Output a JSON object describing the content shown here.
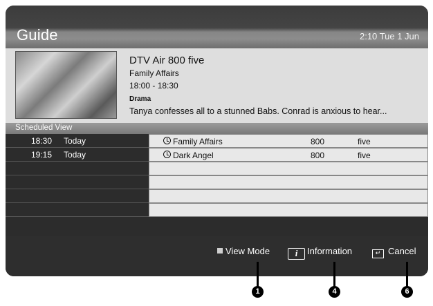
{
  "header": {
    "title": "Guide",
    "datetime": "2:10 Tue 1 Jun"
  },
  "current_programme": {
    "thumbnail_icon": "programme-thumbnail",
    "channel_line": "DTV Air 800 five",
    "title": "Family Affairs",
    "time": "18:00 - 18:30",
    "genre": "Drama",
    "synopsis": "Tanya confesses all to a stunned Babs. Conrad is anxious to hear..."
  },
  "scheduled": {
    "label": "Scheduled View",
    "rows": [
      {
        "time": "18:30",
        "day": "Today",
        "name": "Family Affairs",
        "number": "800",
        "channel": "five"
      },
      {
        "time": "19:15",
        "day": "Today",
        "name": "Dark Angel",
        "number": "800",
        "channel": "five"
      },
      {
        "time": "",
        "day": "",
        "name": "",
        "number": "",
        "channel": ""
      },
      {
        "time": "",
        "day": "",
        "name": "",
        "number": "",
        "channel": ""
      },
      {
        "time": "",
        "day": "",
        "name": "",
        "number": "",
        "channel": ""
      },
      {
        "time": "",
        "day": "",
        "name": "",
        "number": "",
        "channel": ""
      }
    ]
  },
  "footer": {
    "view_mode_label": "View Mode",
    "view_mode_key_icon": "a-button-icon",
    "information_label": "Information",
    "information_key_icon": "info-icon",
    "information_key_glyph": "i",
    "cancel_label": "Cancel",
    "cancel_key_icon": "return-icon"
  },
  "callouts": [
    "1",
    "4",
    "6"
  ]
}
